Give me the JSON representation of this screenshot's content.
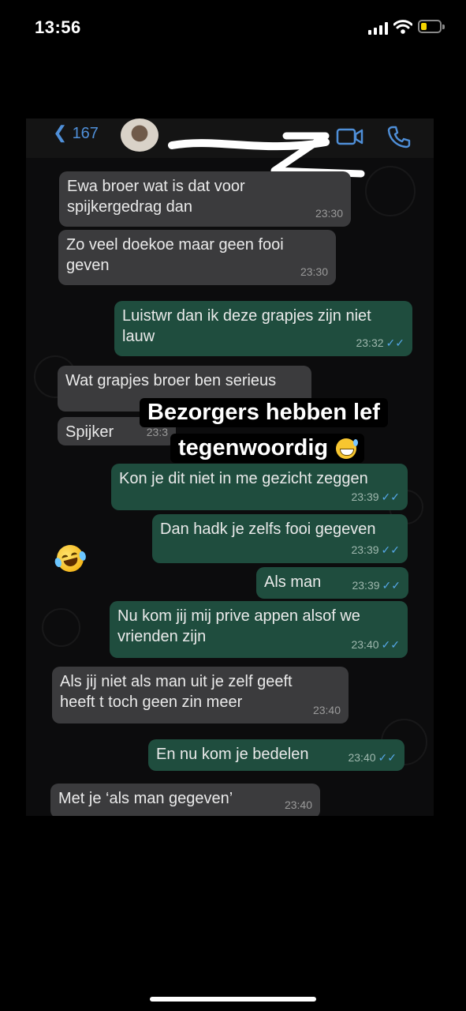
{
  "status_bar": {
    "time": "13:56"
  },
  "chat": {
    "back_count": "167",
    "header_icons": [
      "video-call-icon",
      "phone-call-icon"
    ],
    "messages": [
      {
        "dir": "in",
        "text": "Ewa broer wat is dat voor spijkergedrag dan",
        "time": "23:30"
      },
      {
        "dir": "in",
        "text": "Zo veel doekoe maar geen fooi geven",
        "time": "23:30"
      },
      {
        "dir": "out",
        "text": "Luistwr dan ik deze grapjes zijn niet lauw",
        "time": "23:32"
      },
      {
        "dir": "in",
        "text": "Wat grapjes broer ben serieus",
        "time": ""
      },
      {
        "dir": "in",
        "text": "Spijker",
        "time": "23:3"
      },
      {
        "dir": "out",
        "text": "Kon je dit niet in me gezicht zeggen",
        "time": "23:39"
      },
      {
        "dir": "out",
        "text": "Dan hadk je zelfs fooi gegeven",
        "time": "23:39"
      },
      {
        "dir": "out",
        "text": "Als man",
        "time": "23:39"
      },
      {
        "dir": "out",
        "text": "Nu kom jij mij prive appen alsof we vrienden zijn",
        "time": "23:40"
      },
      {
        "dir": "in",
        "text": "Als jij niet als man uit je zelf geeft heeft t toch geen zin meer",
        "time": "23:40"
      },
      {
        "dir": "out",
        "text": "En nu kom je bedelen",
        "time": "23:40"
      },
      {
        "dir": "in",
        "text": "Met je ‘als man gegeven’",
        "time": "23:40"
      }
    ],
    "read_ticks": "✓✓"
  },
  "story_caption": {
    "line1": "Bezorgers hebben lef",
    "line2": "tegenwoordig"
  },
  "colors": {
    "incoming": "#3b3b3d",
    "outgoing": "#1f4d3e",
    "link": "#4f8fd8",
    "ticks": "#55a6e6"
  }
}
